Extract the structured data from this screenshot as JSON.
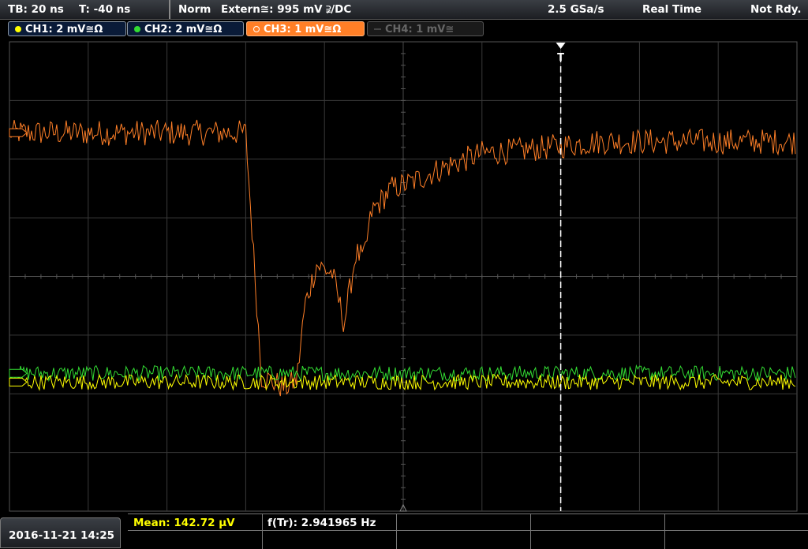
{
  "header": {
    "timebase": "TB: 20 ns",
    "trigger_time": "T: -40 ns",
    "trigger_mode": "Norm",
    "trigger_source": "Extern≅: 995 mV ⫌/DC",
    "sample_rate": "2.5 GSa/s",
    "acq_mode": "Real Time",
    "status": "Not Rdy."
  },
  "channels": [
    {
      "label": "CH1: 2 mV≅Ω",
      "color": "#ffff00"
    },
    {
      "label": "CH2: 2 mV≅Ω",
      "color": "#33dd33"
    },
    {
      "label": "CH3: 1 mV≅Ω",
      "color": "#ff7f27"
    },
    {
      "label": "CH4: 1 mV≅",
      "color": "#555555"
    }
  ],
  "trigger_marker": "T",
  "footer": {
    "datetime": "2016-11-21 14:25",
    "meas1": "Mean: 142.72 µV",
    "meas2": "f(Tr): 2.941965 Hz"
  },
  "chart_data": {
    "type": "line",
    "xlabel": "",
    "ylabel": "",
    "grid": true,
    "x_divisions": 10,
    "y_divisions": 8,
    "x_range_ns": [
      -140,
      60
    ],
    "series": [
      {
        "name": "CH3",
        "color": "#ff7f27",
        "points": [
          [
            -140,
            2.45
          ],
          [
            -80,
            2.45
          ],
          [
            -76,
            -1.7
          ],
          [
            -70,
            -1.9
          ],
          [
            -67,
            -1.75
          ],
          [
            -65,
            -0.5
          ],
          [
            -62,
            0.2
          ],
          [
            -58,
            0.05
          ],
          [
            -55,
            -0.8
          ],
          [
            -52,
            0.4
          ],
          [
            -50,
            0.3
          ],
          [
            -48,
            1.1
          ],
          [
            -43,
            1.5
          ],
          [
            -38,
            1.6
          ],
          [
            -30,
            1.85
          ],
          [
            -20,
            2.1
          ],
          [
            -10,
            2.15
          ],
          [
            10,
            2.3
          ],
          [
            60,
            2.3
          ]
        ]
      },
      {
        "name": "CH2",
        "color": "#33dd33",
        "level": -1.65
      },
      {
        "name": "CH1",
        "color": "#ffff00",
        "level": -1.8
      }
    ]
  }
}
